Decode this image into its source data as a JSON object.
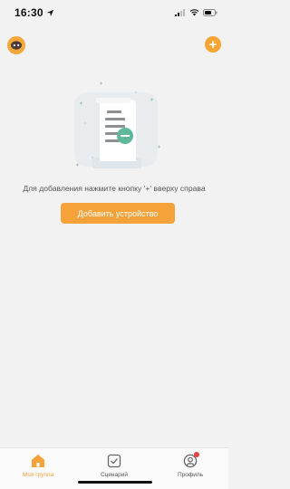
{
  "status_bar": {
    "time": "16:30",
    "icons": [
      "location-arrow-icon",
      "signal-icon",
      "wifi-icon",
      "battery-icon"
    ]
  },
  "header": {
    "avatar_icon": "robot-avatar-icon",
    "add_button_icon": "plus-icon",
    "add_button_glyph": "+",
    "accent_color": "#f5a23b"
  },
  "empty_state": {
    "illustration": "empty-document-illustration",
    "hint": "Для добавления нажмите кнопку '+' вверху справа",
    "add_device_label": "Добавить устройство"
  },
  "tabbar": {
    "tabs": [
      {
        "label": "Моя группа",
        "icon": "home-icon",
        "active": true
      },
      {
        "label": "Сценарий",
        "icon": "checkbox-icon",
        "active": false
      },
      {
        "label": "Профиль",
        "icon": "profile-icon",
        "active": false,
        "badge": true
      }
    ]
  }
}
